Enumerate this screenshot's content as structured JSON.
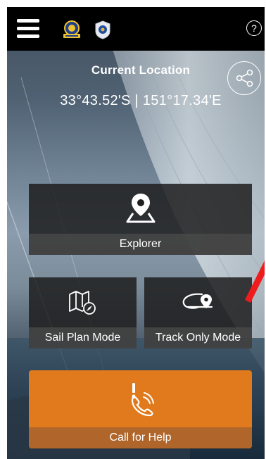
{
  "header": {
    "menu_icon": "hamburger-menu-icon",
    "logos": [
      "coast-guard-logo",
      "marine-rescue-logo"
    ],
    "help_label": "?"
  },
  "location": {
    "title": "Current Location",
    "coordinates": "33°43.52'S | 151°17.34'E",
    "share_icon": "share-icon"
  },
  "tiles": {
    "explorer": {
      "label": "Explorer",
      "icon": "map-pin-icon"
    },
    "sail_plan": {
      "label": "Sail Plan Mode",
      "icon": "map-compass-icon"
    },
    "track_only": {
      "label": "Track Only Mode",
      "icon": "track-pin-icon"
    },
    "call_help": {
      "label": "Call for Help",
      "icon": "phone-alert-icon"
    }
  },
  "colors": {
    "topbar": "#000000",
    "tile_bg": "#1e1e1e",
    "help_orange": "#e07a1c",
    "annotation_arrow": "#ee1c1c"
  }
}
